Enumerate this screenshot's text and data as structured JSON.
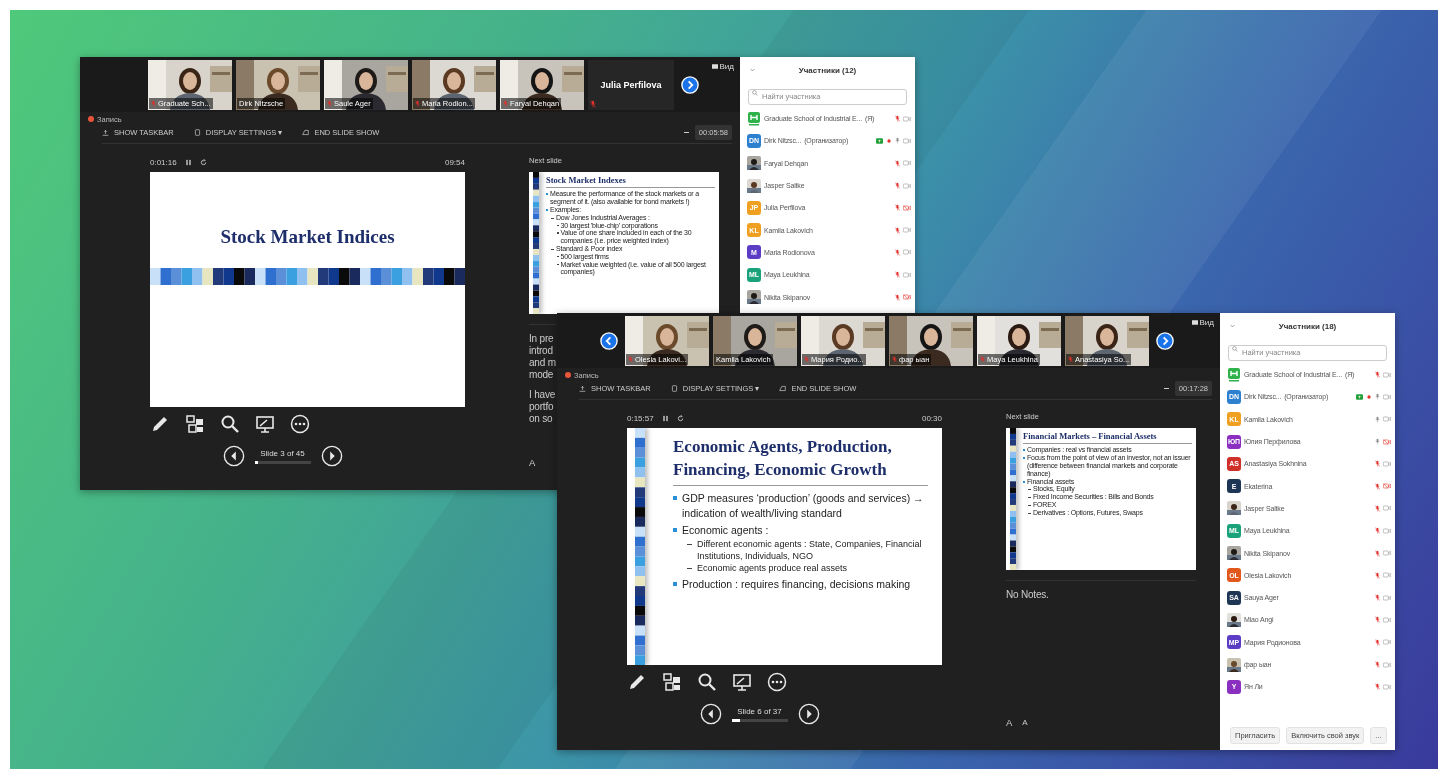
{
  "windows": [
    {
      "video_strip": {
        "prev_arrow": false,
        "next_arrow": true,
        "tiles": [
          {
            "name": "Graduate Sch...",
            "muted": true
          },
          {
            "name": "Dirk Nitzsche",
            "muted": false
          },
          {
            "name": "Saule Ager",
            "muted": true
          },
          {
            "name": "Maria Rodion...",
            "muted": true
          },
          {
            "name": "Faryal Dehqan",
            "muted": true
          }
        ],
        "speaker": {
          "name": "Julia Perfilova",
          "muted": true
        }
      },
      "view_button": "Вид",
      "recording": "Запись",
      "toolbar": [
        "SHOW TASKBAR",
        "DISPLAY SETTINGS ▾",
        "END SLIDE SHOW"
      ],
      "meeting_time": "00:05:58",
      "elapsed": "0:01:16",
      "clock": "09:54",
      "slide": {
        "kind": "title",
        "title": "Stock Market Indices"
      },
      "slide_counter": "Slide 3 of 45",
      "progress": {
        "level": 0.07
      },
      "next_label": "Next slide",
      "next_slide": {
        "kind": "bullets",
        "title": "Stock Market Indexes",
        "bullets": [
          {
            "text": "Measure the performance of the stock markets or a segment of it. (also available for bond markets !)"
          },
          {
            "text": "Examples:",
            "children": [
              {
                "text": "Dow Jones Industrial Averages :",
                "children": [
                  {
                    "text": "30 largest 'blue-chip' corporations"
                  },
                  {
                    "text": "Value of one share included in each of the 30 companies (i.e. price weighted index)"
                  }
                ]
              },
              {
                "text": "Standard & Poor index",
                "children": [
                  {
                    "text": "500 largest firms"
                  },
                  {
                    "text": "Market value weighted (i.e. value of all 500 largest companies)"
                  }
                ]
              }
            ]
          }
        ]
      },
      "notes": [
        [
          "In pre",
          "introd",
          "and m",
          "mode"
        ],
        [
          "I have",
          "portfo",
          "on so"
        ]
      ],
      "font_buttons": [
        "A"
      ],
      "participants": {
        "title": "Участники (12)",
        "search": {
          "placeholder": "Найти участника"
        },
        "rows": [
          {
            "name": "Graduate School of Industrial E...",
            "tag": "(Я)",
            "avatar": {
              "kind": "logo"
            },
            "sharing": false,
            "muted": true,
            "video_blocked": false
          },
          {
            "name": "Dirk Nitzsc...",
            "tag": "(Организатор)",
            "avatar": {
              "kind": "initials",
              "initials": "DN",
              "color": "#2d7fd0"
            },
            "sharing": true,
            "muted": false,
            "video_blocked": false
          },
          {
            "name": "Faryal Dehqan",
            "sharing": false,
            "muted": true,
            "video_blocked": false
          },
          {
            "name": "Jasper Saltke",
            "sharing": false,
            "muted": true,
            "video_blocked": false
          },
          {
            "name": "Julia Perfilova",
            "avatar": {
              "kind": "initials",
              "initials": "JP",
              "color": "#f0a020"
            },
            "sharing": false,
            "muted": true,
            "video_blocked": true
          },
          {
            "name": "Kamila Lakovich",
            "avatar": {
              "kind": "initials",
              "initials": "KL",
              "color": "#f0a020"
            },
            "sharing": false,
            "muted": true,
            "video_blocked": false
          },
          {
            "name": "Maria Rodionova",
            "avatar": {
              "kind": "initials",
              "initials": "M",
              "color": "#5b3cc4"
            },
            "sharing": false,
            "muted": true,
            "video_blocked": false
          },
          {
            "name": "Maya Leukhina",
            "avatar": {
              "kind": "initials",
              "initials": "ML",
              "color": "#1aa37a"
            },
            "sharing": false,
            "muted": true,
            "video_blocked": false
          },
          {
            "name": "Nikita Skipanov",
            "sharing": false,
            "muted": true,
            "video_blocked": true
          }
        ]
      }
    },
    {
      "video_strip": {
        "prev_arrow": true,
        "next_arrow": true,
        "tiles": [
          {
            "name": "Olesia Lakovi...",
            "muted": true
          },
          {
            "name": "Kamila Lakovich",
            "muted": false
          },
          {
            "name": "Мария Родио...",
            "muted": true
          },
          {
            "name": "фар ыан",
            "muted": true
          },
          {
            "name": "Maya Leukhina",
            "muted": true
          },
          {
            "name": "Anastasiya So...",
            "muted": true
          }
        ]
      },
      "view_button": "Вид",
      "recording": "Запись",
      "toolbar": [
        "SHOW TASKBAR",
        "DISPLAY SETTINGS ▾",
        "END SLIDE SHOW"
      ],
      "meeting_time": "00:17:28",
      "elapsed": "0:15:57",
      "clock": "00:30",
      "slide": {
        "kind": "bullets",
        "title": "Economic Agents, Production, Financing, Economic Growth",
        "bullets": [
          {
            "text": "GDP measures ‘production’ (goods and services) → indication of wealth/living standard"
          },
          {
            "text": "Economic agents :",
            "children": [
              {
                "text": "Different economic agents : State, Companies, Financial Institutions, Individuals, NGO"
              },
              {
                "text": "Economic agents produce real assets"
              }
            ]
          },
          {
            "text": "Production : requires financing, decisions making"
          }
        ]
      },
      "slide_counter": "Slide 6 of 37",
      "progress": {
        "level": 0.16
      },
      "next_label": "Next slide",
      "next_slide": {
        "kind": "bullets",
        "title": "Financial Markets – Financial Assets",
        "bullets": [
          {
            "text": "Companies : real vs financial assets"
          },
          {
            "text": "Focus from the point of view of an investor, not an issuer (difference between financial markets and corporate finance)"
          },
          {
            "text": "Financial assets",
            "children": [
              {
                "text": "Stocks, Equity"
              },
              {
                "text": "Fixed Income Securities : Bills and Bonds"
              },
              {
                "text": "FOREX"
              },
              {
                "text": "Derivatives : Options, Futures, Swaps"
              }
            ]
          }
        ]
      },
      "notes": [
        [
          "No Notes."
        ]
      ],
      "font_buttons": [
        "A",
        "A"
      ],
      "participants": {
        "title": "Участники (18)",
        "search": {
          "placeholder": "Найти участника"
        },
        "rows": [
          {
            "name": "Graduate School of Industrial E...",
            "tag": "(Я)",
            "avatar": {
              "kind": "logo"
            },
            "sharing": false,
            "muted": true,
            "video_blocked": false
          },
          {
            "name": "Dirk Nitzsc...",
            "tag": "(Организатор)",
            "avatar": {
              "kind": "initials",
              "initials": "DN",
              "color": "#2d7fd0"
            },
            "sharing": true,
            "muted": false,
            "video_blocked": false
          },
          {
            "name": "Kamila Lakovich",
            "avatar": {
              "kind": "initials",
              "initials": "KL",
              "color": "#f0a020"
            },
            "sharing": false,
            "muted": false,
            "video_blocked": false
          },
          {
            "name": "Юлия Перфилова",
            "avatar": {
              "kind": "initials",
              "initials": "ЮП",
              "color": "#8a2fc0"
            },
            "sharing": false,
            "muted": false,
            "video_blocked": true
          },
          {
            "name": "Anastasiya Sokhnina",
            "avatar": {
              "kind": "initials",
              "initials": "AS",
              "color": "#d0302a"
            },
            "sharing": false,
            "muted": true,
            "video_blocked": false
          },
          {
            "name": "Ekaterina",
            "avatar": {
              "kind": "initials",
              "initials": "E",
              "color": "#1e3556"
            },
            "sharing": false,
            "muted": true,
            "video_blocked": true
          },
          {
            "name": "Jasper Saltke",
            "sharing": false,
            "muted": true,
            "video_blocked": false
          },
          {
            "name": "Maya Leukhina",
            "avatar": {
              "kind": "initials",
              "initials": "ML",
              "color": "#1aa37a"
            },
            "sharing": false,
            "muted": true,
            "video_blocked": false
          },
          {
            "name": "Nikita Skipanov",
            "sharing": false,
            "muted": true,
            "video_blocked": false
          },
          {
            "name": "Olesia Lakovich",
            "avatar": {
              "kind": "initials",
              "initials": "OL",
              "color": "#e2581c"
            },
            "sharing": false,
            "muted": true,
            "video_blocked": false
          },
          {
            "name": "Sauya Ager",
            "avatar": {
              "kind": "initials",
              "initials": "SA",
              "color": "#1e3556"
            },
            "sharing": false,
            "muted": true,
            "video_blocked": false
          },
          {
            "name": "Miao Angi",
            "sharing": false,
            "muted": true,
            "video_blocked": false
          },
          {
            "name": "Мария Родионова",
            "avatar": {
              "kind": "initials",
              "initials": "МР",
              "color": "#5b3cc4"
            },
            "sharing": false,
            "muted": true,
            "video_blocked": false
          },
          {
            "name": "фар ыан",
            "sharing": false,
            "muted": true,
            "video_blocked": false
          },
          {
            "name": "Ян Ли",
            "avatar": {
              "kind": "initials",
              "initials": "Y",
              "color": "#8a2fc0"
            },
            "sharing": false,
            "muted": true,
            "video_blocked": false
          }
        ],
        "buttons": [
          "Пригласить",
          "Включить свой звук",
          "..."
        ]
      }
    }
  ]
}
